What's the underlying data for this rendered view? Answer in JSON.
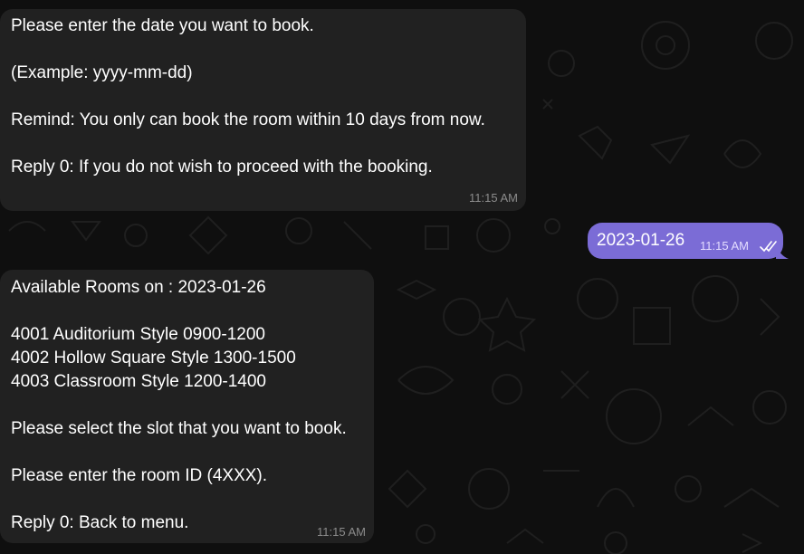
{
  "messages": [
    {
      "direction": "incoming",
      "lines": [
        "Please enter the date you want to book.",
        "",
        "(Example: yyyy-mm-dd)",
        "",
        "Remind: You only can book the room within 10 days from now.",
        "",
        "Reply 0: If you do not wish to proceed with the booking."
      ],
      "time": "11:15 AM"
    },
    {
      "direction": "outgoing",
      "lines": [
        "2023-01-26"
      ],
      "time": "11:15 AM",
      "status": "read",
      "status_icon": "double-check-icon"
    },
    {
      "direction": "incoming",
      "lines": [
        "Available Rooms on : 2023-01-26",
        "",
        "4001 Auditorium Style 0900-1200",
        "4002 Hollow Square Style 1300-1500",
        "4003 Classroom Style 1200-1400",
        "",
        "Please select the slot that you want to book.",
        "",
        "Please enter the room ID (4XXX).",
        "",
        "Reply 0: Back to menu."
      ],
      "time": "11:15 AM"
    }
  ],
  "colors": {
    "background": "#0f0f0f",
    "incoming_bubble": "#212121",
    "outgoing_bubble": "#7b6cd6",
    "text": "#ffffff",
    "timestamp": "#8c8c8c"
  }
}
